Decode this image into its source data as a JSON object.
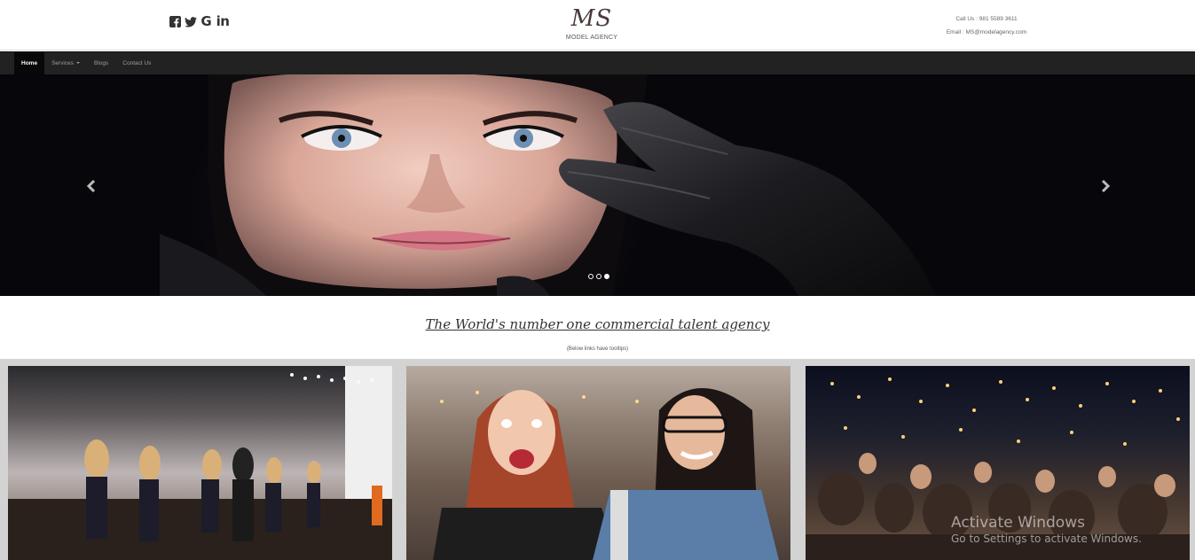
{
  "header": {
    "social_icons": [
      "facebook-icon",
      "twitter-icon",
      "google-icon",
      "linkedin-icon"
    ],
    "google_glyph": "G",
    "linkedin_glyph": "in",
    "logo_mark": "MS",
    "logo_subtitle": "MODEL AGENCY",
    "call": "Call Us : 981 5589 3611",
    "email": "Email : MS@modelagency.com"
  },
  "nav": {
    "items": [
      {
        "label": "Home",
        "active": true
      },
      {
        "label": "Services",
        "dropdown": true
      },
      {
        "label": "Blogs"
      },
      {
        "label": "Contact Us"
      }
    ]
  },
  "carousel": {
    "slide_count": 3,
    "active_index": 2,
    "prev_icon": "chevron-left-icon",
    "next_icon": "chevron-right-icon"
  },
  "tagline": {
    "title": "The World's number one commercial talent agency",
    "note": "(Below links have tooltips)"
  },
  "gallery": {
    "cards": [
      "runway-photo",
      "friends-photo",
      "concert-crowd-photo"
    ]
  },
  "watermark": {
    "title": "Activate Windows",
    "subtitle": "Go to Settings to activate Windows."
  },
  "colors": {
    "navbar_bg": "#222222",
    "nav_active_bg": "#080808",
    "gallery_bg": "#d3d3d3"
  }
}
